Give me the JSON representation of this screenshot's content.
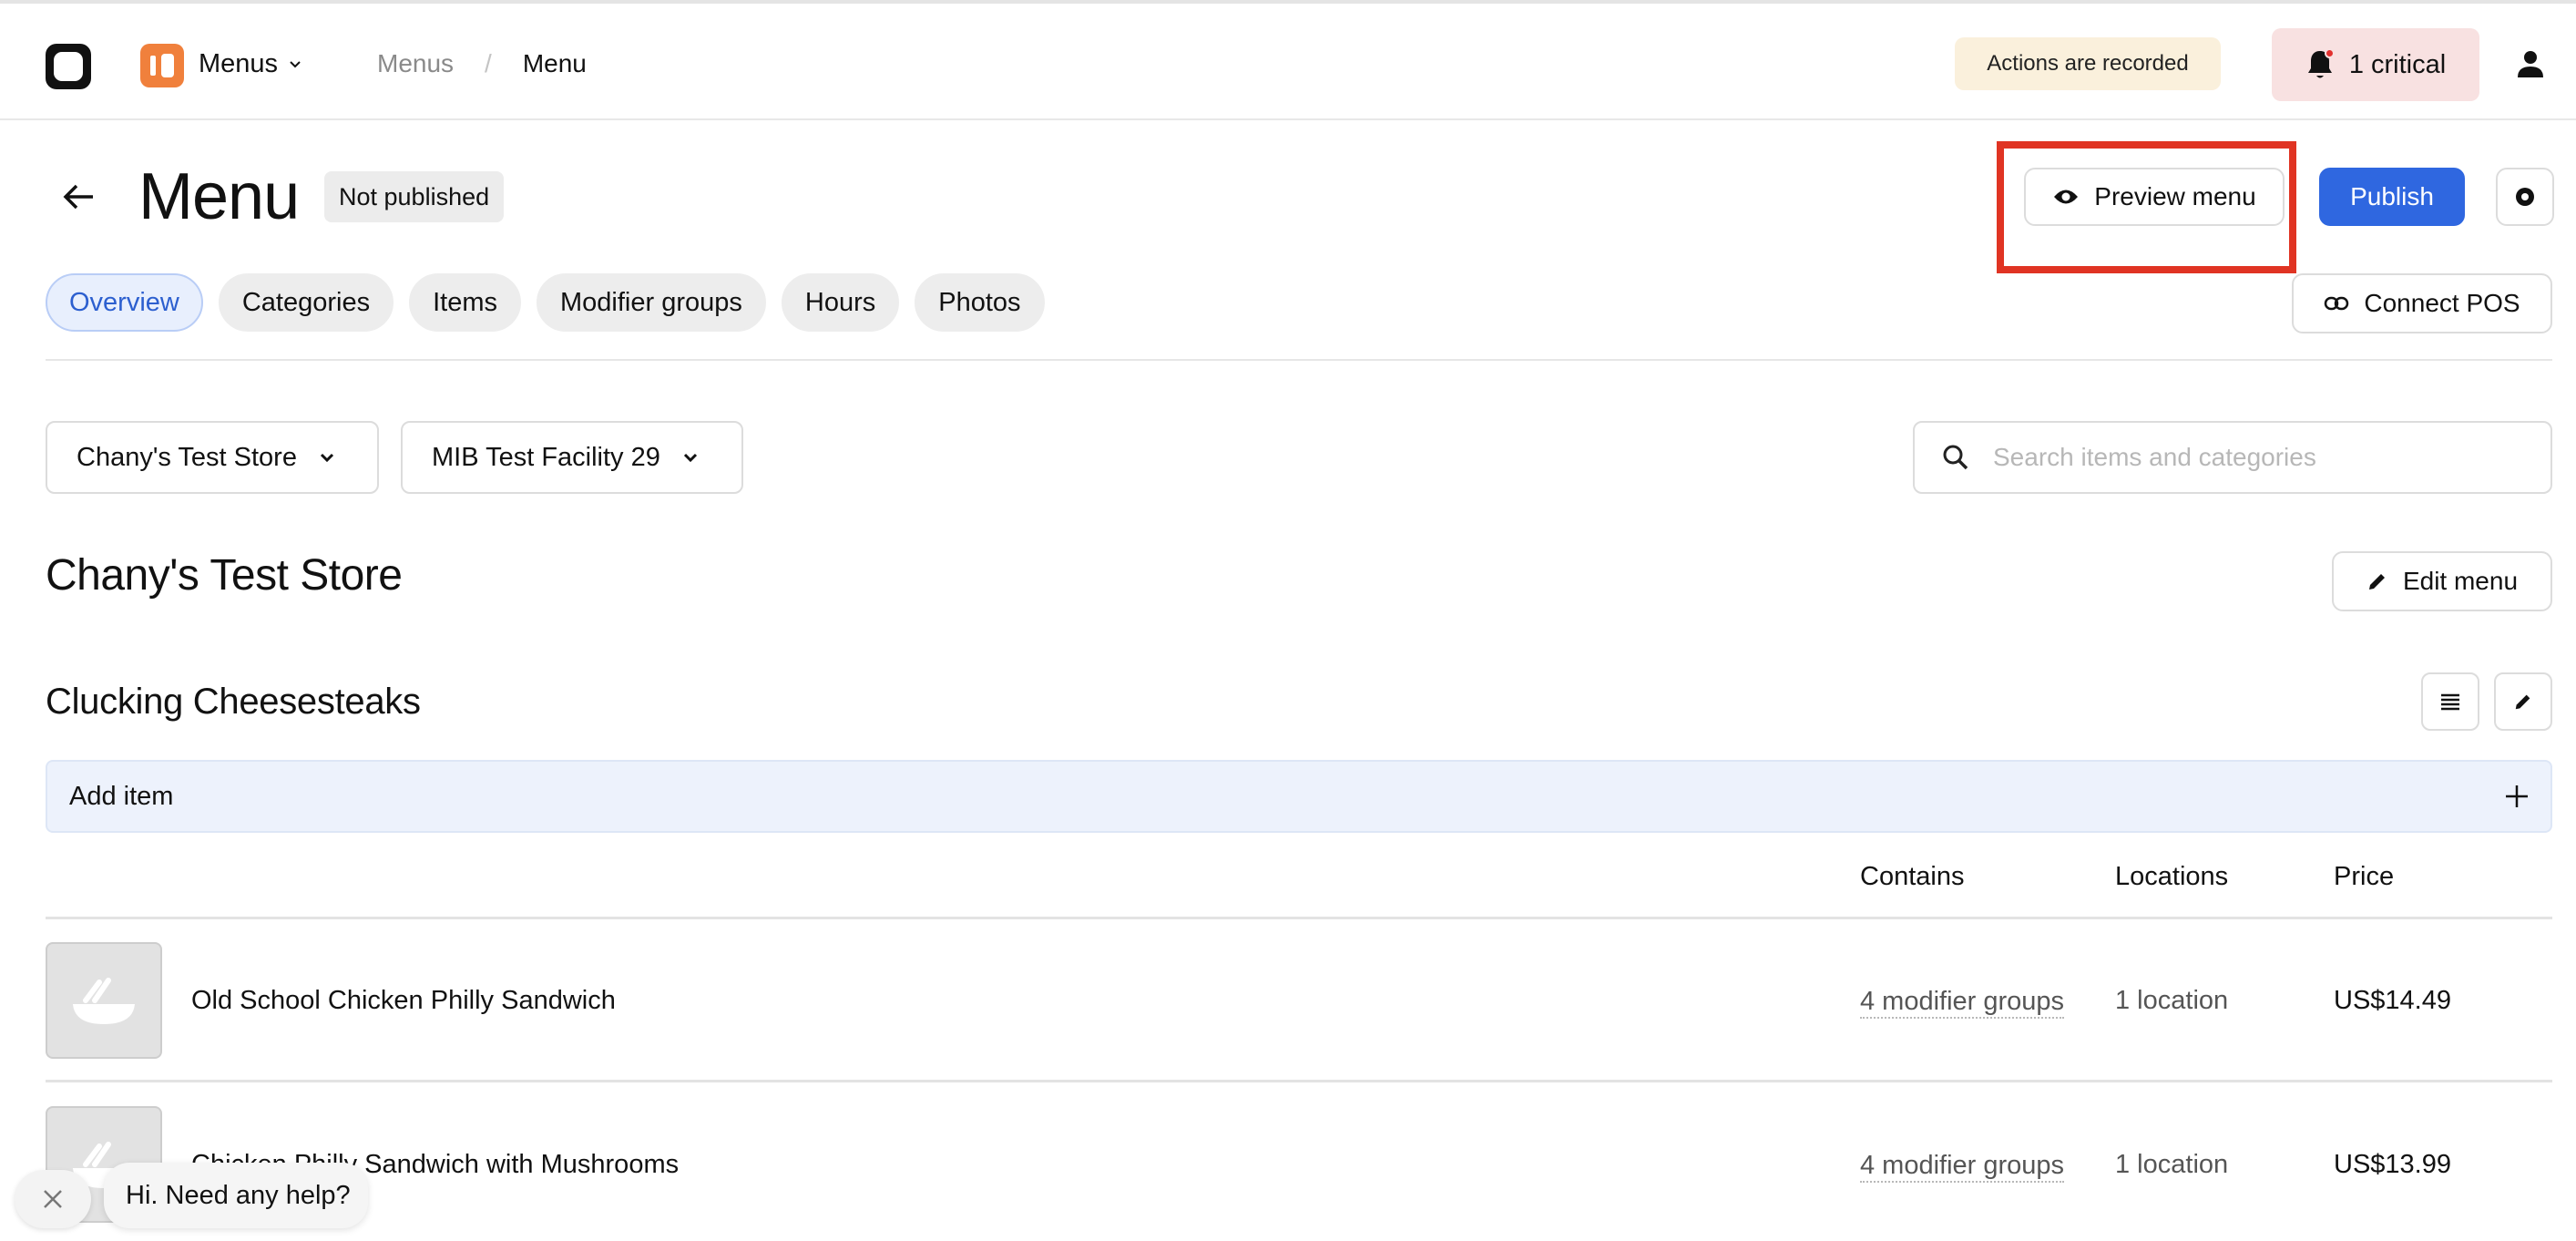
{
  "topbar": {
    "app_name": "Menus",
    "breadcrumb": [
      {
        "label": "Menus"
      },
      {
        "label": "Menu"
      }
    ],
    "recording_notice": "Actions are recorded",
    "alerts_label": "1 critical"
  },
  "page": {
    "title": "Menu",
    "status": "Not published",
    "preview_label": "Preview menu",
    "publish_label": "Publish",
    "connect_pos_label": "Connect POS"
  },
  "tabs": [
    {
      "label": "Overview",
      "active": true
    },
    {
      "label": "Categories",
      "active": false
    },
    {
      "label": "Items",
      "active": false
    },
    {
      "label": "Modifier groups",
      "active": false
    },
    {
      "label": "Hours",
      "active": false
    },
    {
      "label": "Photos",
      "active": false
    }
  ],
  "filters": {
    "store": "Chany's Test Store",
    "facility": "MIB Test Facility 29",
    "search_placeholder": "Search items and categories"
  },
  "store": {
    "title": "Chany's Test Store",
    "edit_menu_label": "Edit menu"
  },
  "category": {
    "title": "Clucking Cheesesteaks",
    "add_item_label": "Add item",
    "columns": {
      "contains": "Contains",
      "locations": "Locations",
      "price": "Price"
    },
    "items": [
      {
        "name": "Old School Chicken Philly Sandwich",
        "contains": "4 modifier groups",
        "locations": "1 location",
        "price": "US$14.49"
      },
      {
        "name": "Chicken Philly Sandwich with Mushrooms",
        "contains": "4 modifier groups",
        "locations": "1 location",
        "price": "US$13.99"
      }
    ]
  },
  "chat": {
    "message": "Hi. Need any help?"
  },
  "colors": {
    "accent": "#2f67e0",
    "active_tab_bg": "#e8effd",
    "active_tab_text": "#2c5fcf",
    "brand_orange": "#f0803c",
    "critical_bg": "#f8e1e1",
    "notice_bg": "#faf0dc",
    "annotation_red": "#e03423"
  },
  "icons": [
    "logo-icon",
    "app-icon",
    "chevron-down-icon",
    "bell-icon",
    "user-icon",
    "arrow-left-icon",
    "eye-icon",
    "gear-icon",
    "link-icon",
    "search-icon",
    "pencil-icon",
    "list-icon",
    "plus-icon",
    "bowl-placeholder-icon",
    "close-icon"
  ]
}
